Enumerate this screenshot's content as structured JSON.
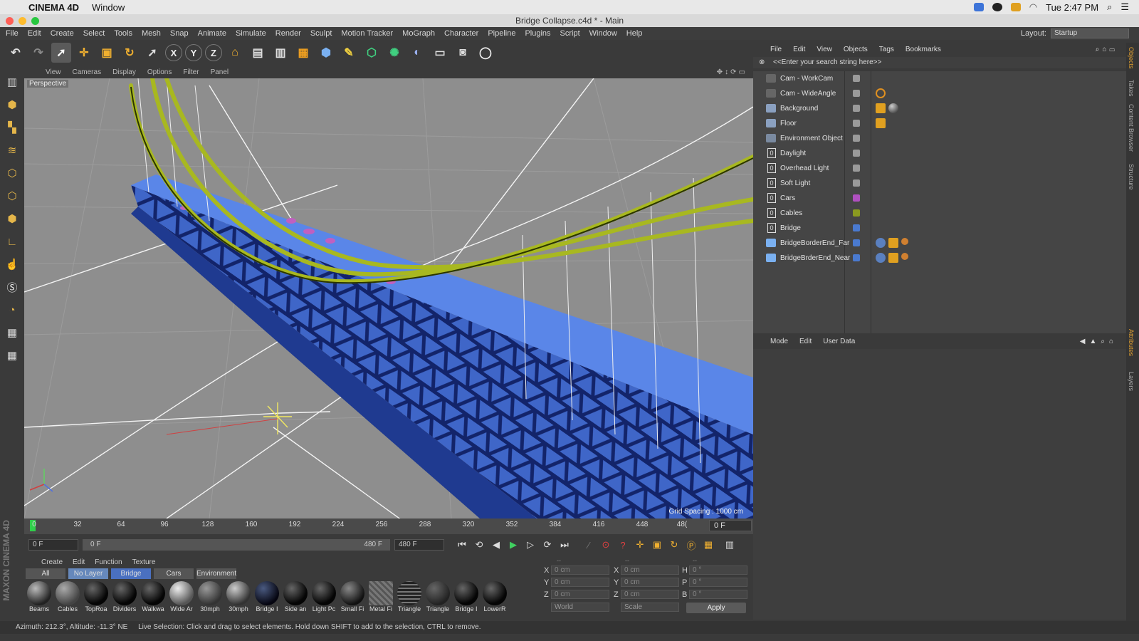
{
  "mac_menu": {
    "app_name": "CINEMA 4D",
    "window_menu": "Window",
    "clock": "Tue 2:47 PM"
  },
  "title": "Bridge Collapse.c4d * - Main",
  "menu": [
    "File",
    "Edit",
    "Create",
    "Select",
    "Tools",
    "Mesh",
    "Snap",
    "Animate",
    "Simulate",
    "Render",
    "Sculpt",
    "Motion Tracker",
    "MoGraph",
    "Character",
    "Pipeline",
    "Plugins",
    "Script",
    "Window",
    "Help"
  ],
  "layout": {
    "label": "Layout:",
    "value": "Startup"
  },
  "viewport": {
    "menu": [
      "View",
      "Cameras",
      "Display",
      "Options",
      "Filter",
      "Panel"
    ],
    "label": "Perspective",
    "grid_spacing": "Grid Spacing : 1000 cm"
  },
  "timeline": {
    "ticks": [
      "0",
      "32",
      "64",
      "96",
      "128",
      "160",
      "192",
      "224",
      "256",
      "288",
      "320",
      "352",
      "384",
      "416",
      "448",
      "48("
    ],
    "current_frame": "0 F"
  },
  "transport": {
    "start_field": "0 F",
    "range_min": "0 F",
    "range_max": "480 F",
    "end_field": "480 F"
  },
  "material_manager": {
    "menu": [
      "Create",
      "Edit",
      "Function",
      "Texture"
    ],
    "tabs": [
      "All",
      "No Layer",
      "Bridge",
      "Cars",
      "Environment"
    ],
    "active_tab": "No Layer",
    "materials": [
      "Beams",
      "Cables",
      "TopRoa",
      "Dividers",
      "Walkwa",
      "Wide Ar",
      "30mph",
      "30mph",
      "Bridge I",
      "Side an",
      "Light Pc",
      "Small Fi",
      "Metal Fi",
      "Triangle",
      "Triangle",
      "Bridge I",
      "LowerR"
    ]
  },
  "coordinates": {
    "header": [
      "--",
      "--",
      "--"
    ],
    "rows": [
      {
        "a": "X",
        "a_val": "0 cm",
        "b": "X",
        "b_val": "0 cm",
        "c": "H",
        "c_val": "0 °"
      },
      {
        "a": "Y",
        "a_val": "0 cm",
        "b": "Y",
        "b_val": "0 cm",
        "c": "P",
        "c_val": "0 °"
      },
      {
        "a": "Z",
        "a_val": "0 cm",
        "b": "Z",
        "b_val": "0 cm",
        "c": "B",
        "c_val": "0 °"
      }
    ],
    "mode_1": "World",
    "mode_2": "Scale",
    "apply": "Apply"
  },
  "status": {
    "azimuth": "Azimuth: 212.3°, Altitude: -11.3°  NE",
    "hint": "Live Selection: Click and drag to select elements. Hold down SHIFT to add to the selection, CTRL to remove."
  },
  "object_manager": {
    "menu": [
      "File",
      "Edit",
      "View",
      "Objects",
      "Tags",
      "Bookmarks"
    ],
    "search_placeholder": "<<Enter your search string here>>",
    "objects": [
      {
        "name": "Cam - WorkCam",
        "icon": "camera",
        "layer": "#9a9a9a"
      },
      {
        "name": "Cam - WideAngle",
        "icon": "camera",
        "layer": "#9a9a9a"
      },
      {
        "name": "Background",
        "icon": "background",
        "layer": "#9a9a9a"
      },
      {
        "name": "Floor",
        "icon": "floor",
        "layer": "#9a9a9a"
      },
      {
        "name": "Environment Object",
        "icon": "environment",
        "layer": "#9a9a9a"
      },
      {
        "name": "Daylight",
        "icon": "null",
        "layer": "#9a9a9a"
      },
      {
        "name": "Overhead Light",
        "icon": "null",
        "layer": "#9a9a9a"
      },
      {
        "name": "Soft Light",
        "icon": "null",
        "layer": "#9a9a9a"
      },
      {
        "name": "Cars",
        "icon": "null",
        "layer": "#b050c0"
      },
      {
        "name": "Cables",
        "icon": "null",
        "layer": "#8a9a20"
      },
      {
        "name": "Bridge",
        "icon": "null",
        "layer": "#4a7ad0"
      },
      {
        "name": "BridgeBorderEnd_Far",
        "icon": "polygon",
        "layer": "#4a7ad0"
      },
      {
        "name": "BridgeBrderEnd_Near",
        "icon": "polygon",
        "layer": "#4a7ad0"
      }
    ]
  },
  "attributes": {
    "menu": [
      "Mode",
      "Edit",
      "User Data"
    ]
  },
  "right_tabs": [
    "Objects",
    "Takes",
    "Content Browser",
    "Structure",
    "Attributes",
    "Layers"
  ],
  "colors": {
    "bridge_blue": "#4f7be0",
    "cable_green": "#a8b820",
    "viewport_bg": "#8e8e8e",
    "timeline_playhead": "#2fd04a"
  }
}
